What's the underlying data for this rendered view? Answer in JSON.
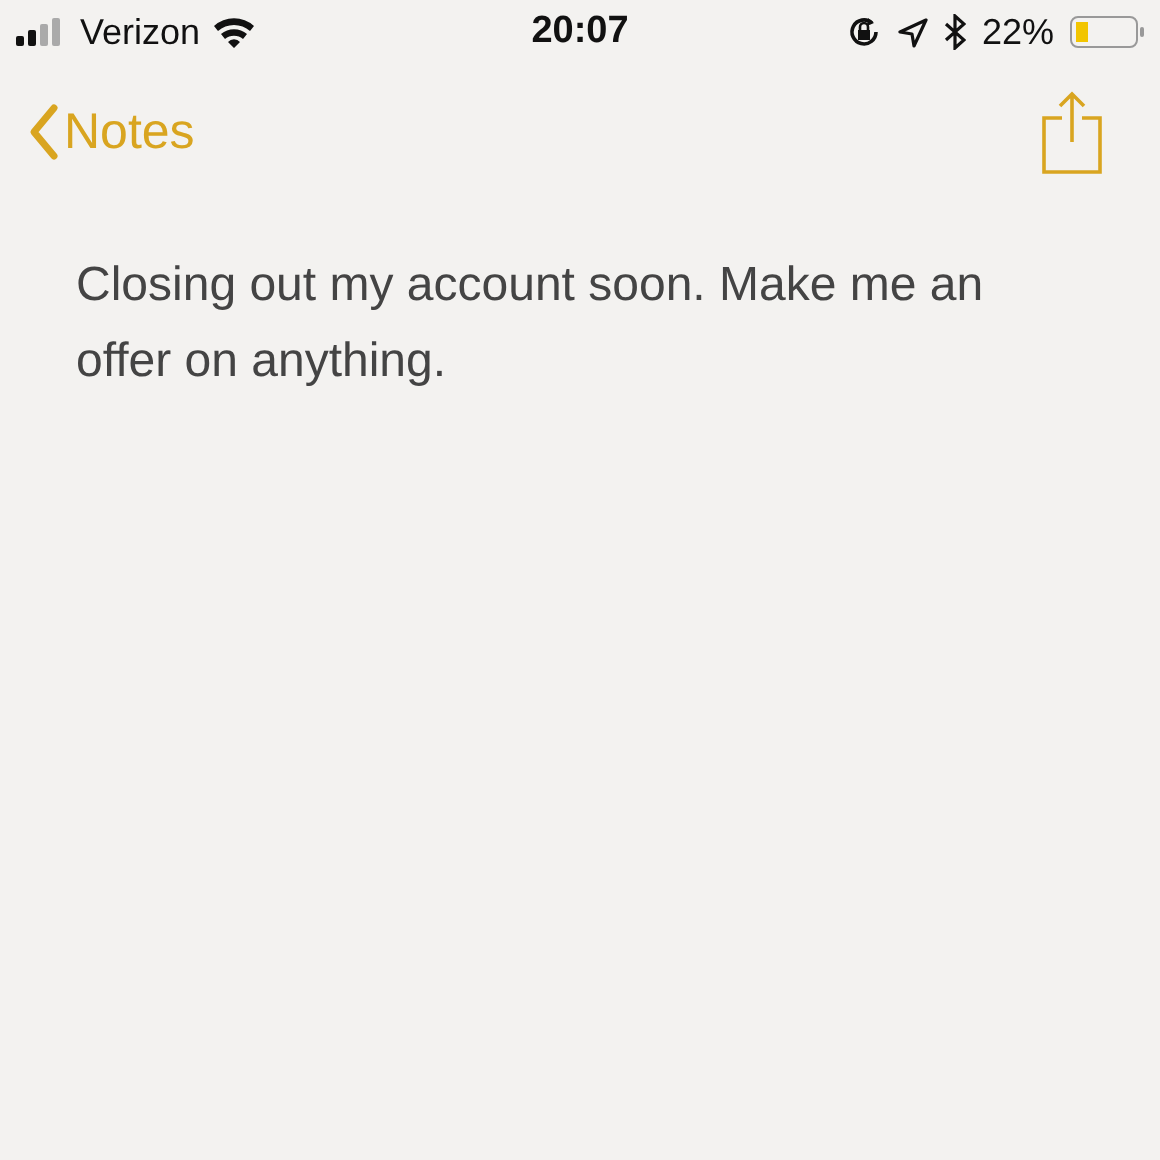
{
  "status_bar": {
    "carrier": "Verizon",
    "time": "20:07",
    "battery": "22%"
  },
  "nav": {
    "back": "Notes"
  },
  "note": {
    "text": "Closing out my account soon. Make me an offer on anything."
  }
}
